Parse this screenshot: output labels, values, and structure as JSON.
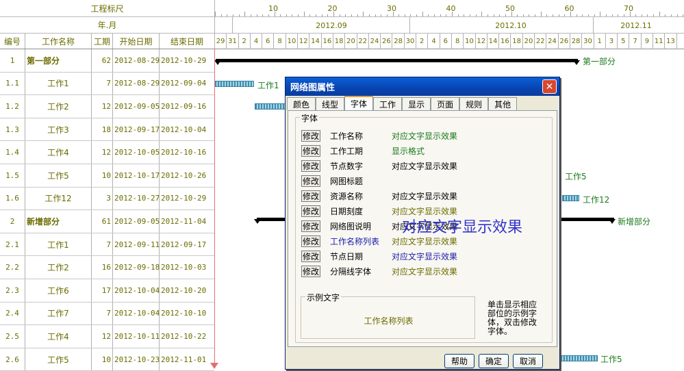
{
  "header": {
    "ruler_title": "工程标尺",
    "year_month_title": "年.月",
    "columns": [
      "编号",
      "工作名称",
      "工期",
      "开始日期",
      "结束日期"
    ],
    "ruler_numbers": [
      "10",
      "20",
      "30",
      "40",
      "50",
      "60",
      "70"
    ],
    "months": [
      "2012.09",
      "2012.10",
      "2012.11"
    ],
    "days": [
      "29",
      "31",
      "2",
      "4",
      "6",
      "8",
      "10",
      "12",
      "14",
      "16",
      "18",
      "20",
      "22",
      "24",
      "26",
      "28",
      "30",
      "2",
      "4",
      "6",
      "8",
      "10",
      "12",
      "14",
      "16",
      "18",
      "20",
      "22",
      "24",
      "26",
      "28",
      "30",
      "1",
      "3",
      "5",
      "7",
      "9",
      "11",
      "13"
    ]
  },
  "rows": [
    {
      "id": "1",
      "name": "第一部分",
      "duration": "62",
      "start": "2012-08-29",
      "end": "2012-10-29",
      "group": true
    },
    {
      "id": "1.1",
      "name": "工作1",
      "duration": "7",
      "start": "2012-08-29",
      "end": "2012-09-04",
      "group": false
    },
    {
      "id": "1.2",
      "name": "工作2",
      "duration": "12",
      "start": "2012-09-05",
      "end": "2012-09-16",
      "group": false
    },
    {
      "id": "1.3",
      "name": "工作3",
      "duration": "18",
      "start": "2012-09-17",
      "end": "2012-10-04",
      "group": false
    },
    {
      "id": "1.4",
      "name": "工作4",
      "duration": "12",
      "start": "2012-10-05",
      "end": "2012-10-16",
      "group": false
    },
    {
      "id": "1.5",
      "name": "工作5",
      "duration": "10",
      "start": "2012-10-17",
      "end": "2012-10-26",
      "group": false
    },
    {
      "id": "1.6",
      "name": "工作12",
      "duration": "3",
      "start": "2012-10-27",
      "end": "2012-10-29",
      "group": false
    },
    {
      "id": "2",
      "name": "新增部分",
      "duration": "61",
      "start": "2012-09-05",
      "end": "2012-11-04",
      "group": true
    },
    {
      "id": "2.1",
      "name": "工作1",
      "duration": "7",
      "start": "2012-09-11",
      "end": "2012-09-17",
      "group": false
    },
    {
      "id": "2.2",
      "name": "工作2",
      "duration": "16",
      "start": "2012-09-18",
      "end": "2012-10-03",
      "group": false
    },
    {
      "id": "2.3",
      "name": "工作6",
      "duration": "17",
      "start": "2012-10-04",
      "end": "2012-10-20",
      "group": false
    },
    {
      "id": "2.4",
      "name": "工作7",
      "duration": "7",
      "start": "2012-10-04",
      "end": "2012-10-10",
      "group": false
    },
    {
      "id": "2.5",
      "name": "工作4",
      "duration": "12",
      "start": "2012-10-11",
      "end": "2012-10-22",
      "group": false
    },
    {
      "id": "2.6",
      "name": "工作5",
      "duration": "10",
      "start": "2012-10-23",
      "end": "2012-11-01",
      "group": false
    }
  ],
  "gantt_labels": {
    "group1": "第一部分",
    "work1": "工作1",
    "work5": "工作5",
    "work12": "工作12",
    "group2": "新增部分",
    "work5b": "工作5"
  },
  "dialog": {
    "title": "网络图属性",
    "close": "✕",
    "tabs": [
      "颜色",
      "线型",
      "字体",
      "工作",
      "显示",
      "页面",
      "规则",
      "其他"
    ],
    "active_tab": "字体",
    "font_group_label": "字体",
    "modify_label": "修改",
    "font_items": [
      {
        "label": "工作名称",
        "sample": "对应文字显示效果",
        "label_color": "#000000",
        "sample_color": "#1a7a1a"
      },
      {
        "label": "工作工期",
        "sample": "显示格式",
        "label_color": "#000000",
        "sample_color": "#1a7a1a"
      },
      {
        "label": "节点数字",
        "sample": "对应文字显示效果",
        "label_color": "#000000",
        "sample_color": "#000000"
      },
      {
        "label": "网图标题",
        "sample": "",
        "label_color": "#000000",
        "sample_color": "#000000"
      },
      {
        "label": "资源名称",
        "sample": "对应文字显示效果",
        "label_color": "#000000",
        "sample_color": "#000000"
      },
      {
        "label": "日期刻度",
        "sample": "对应文字显示效果",
        "label_color": "#000000",
        "sample_color": "#6b6b00"
      },
      {
        "label": "网络图说明",
        "sample": "对应文字显示效果",
        "label_color": "#000000",
        "sample_color": "#000000"
      },
      {
        "label": "工作名称列表",
        "sample": "对应文字显示效果",
        "label_color": "#1a1aaa",
        "sample_color": "#6b6b00"
      },
      {
        "label": "节点日期",
        "sample": "对应文字显示效果",
        "label_color": "#000000",
        "sample_color": "#1a1aaa"
      },
      {
        "label": "分隔线字体",
        "sample": "对应文字显示效果",
        "label_color": "#000000",
        "sample_color": "#6b6b00"
      }
    ],
    "big_preview": "对应文字显示效果",
    "sample_label": "示例文字",
    "sample_text": "工作名称列表",
    "hint": "单击显示相应部位的示例字体，双击修改字体。",
    "buttons": {
      "help": "帮助",
      "ok": "确定",
      "cancel": "取消"
    }
  }
}
